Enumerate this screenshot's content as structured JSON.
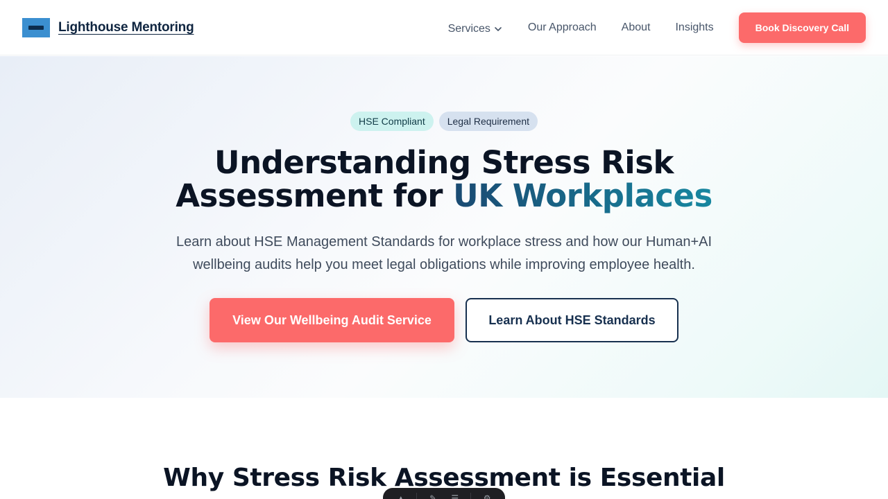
{
  "header": {
    "brand_name": "Lighthouse Mentoring",
    "nav": {
      "services": "Services",
      "approach": "Our Approach",
      "about": "About",
      "insights": "Insights"
    },
    "cta": "Book Discovery Call"
  },
  "hero": {
    "badges": [
      "HSE Compliant",
      "Legal Requirement"
    ],
    "title_line1": "Understanding Stress Risk",
    "title_line2_prefix": "Assessment for ",
    "title_line2_accent": "UK Workplaces",
    "subtitle_line1": "Learn about HSE Management Standards for workplace stress and how our Human+AI",
    "subtitle_line2": "wellbeing audits help you meet legal obligations while improving employee health.",
    "primary_button": "View Our Wellbeing Audit Service",
    "secondary_button": "Learn About HSE Standards"
  },
  "section": {
    "title": "Why Stress Risk Assessment is Essential"
  },
  "colors": {
    "accent": "#fc6a6a",
    "navy": "#17304f",
    "teal": "#1787a0"
  },
  "icons": {
    "services_chevron": "chevron-down-icon",
    "toolbar": [
      "select-icon",
      "draw-icon",
      "menu-icon",
      "settings-icon"
    ]
  }
}
